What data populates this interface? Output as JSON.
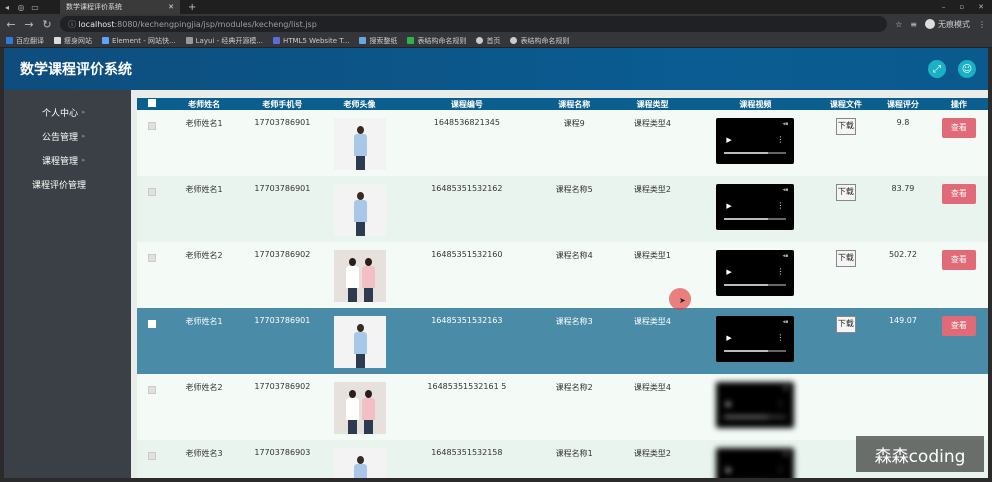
{
  "browser": {
    "tab_title": "数学课程评价系统",
    "url_host": "localhost",
    "url_rest": ":8080/kechengpingjia/jsp/modules/kecheng/list.jsp",
    "profile_label": "无痕模式",
    "bookmarks": [
      "百应翻译",
      "瘦身网站",
      "Element - 网站快...",
      "Layui - 经典开源模...",
      "HTML5 Website T...",
      "搜索整纸",
      "表结构命名规则",
      "首页",
      "表结构命名规则"
    ]
  },
  "app": {
    "title": "数学课程评价系统"
  },
  "sidebar": {
    "items": [
      {
        "label": "个人中心"
      },
      {
        "label": "公告管理"
      },
      {
        "label": "课程管理"
      },
      {
        "label": "课程评价管理"
      }
    ]
  },
  "table": {
    "headers": [
      "老师姓名",
      "老师手机号",
      "老师头像",
      "课程编号",
      "课程名称",
      "课程类型",
      "课程视频",
      "课程文件",
      "课程评分",
      "操作"
    ],
    "rows": [
      {
        "teacher": "老师姓名1",
        "phone": "17703786901",
        "avatar": "single",
        "code": "1648536821345",
        "name": "课程9",
        "type": "课程类型4",
        "file_btn": "下载",
        "score": "9.8",
        "action": "查看",
        "style": "r0"
      },
      {
        "teacher": "老师姓名1",
        "phone": "17703786901",
        "avatar": "single",
        "code": "16485351532162",
        "name": "课程名称5",
        "type": "课程类型2",
        "file_btn": "下载",
        "score": "83.79",
        "action": "查看",
        "style": "r1"
      },
      {
        "teacher": "老师姓名2",
        "phone": "17703786902",
        "avatar": "pair",
        "code": "16485351532160",
        "name": "课程名称4",
        "type": "课程类型1",
        "file_btn": "下载",
        "score": "502.72",
        "action": "查看",
        "style": "r0"
      },
      {
        "teacher": "老师姓名1",
        "phone": "17703786901",
        "avatar": "single",
        "code": "16485351532163",
        "name": "课程名称3",
        "type": "课程类型4",
        "file_btn": "下载",
        "score": "149.07",
        "action": "查看",
        "style": "sel"
      },
      {
        "teacher": "老师姓名2",
        "phone": "17703786902",
        "avatar": "pair",
        "code": "16485351532161 5",
        "name": "课程名称2",
        "type": "课程类型4",
        "file_btn": "",
        "score": "",
        "action": "",
        "style": "r0"
      },
      {
        "teacher": "老师姓名3",
        "phone": "17703786903",
        "avatar": "single",
        "code": "16485351532158",
        "name": "课程名称1",
        "type": "课程类型2",
        "file_btn": "",
        "score": "",
        "action": "",
        "style": "r1"
      }
    ]
  },
  "watermark": "森森coding",
  "colors": {
    "header": "#0b5f8f",
    "view_button": "#e06a77",
    "selected_row": "#4a8ba8"
  }
}
